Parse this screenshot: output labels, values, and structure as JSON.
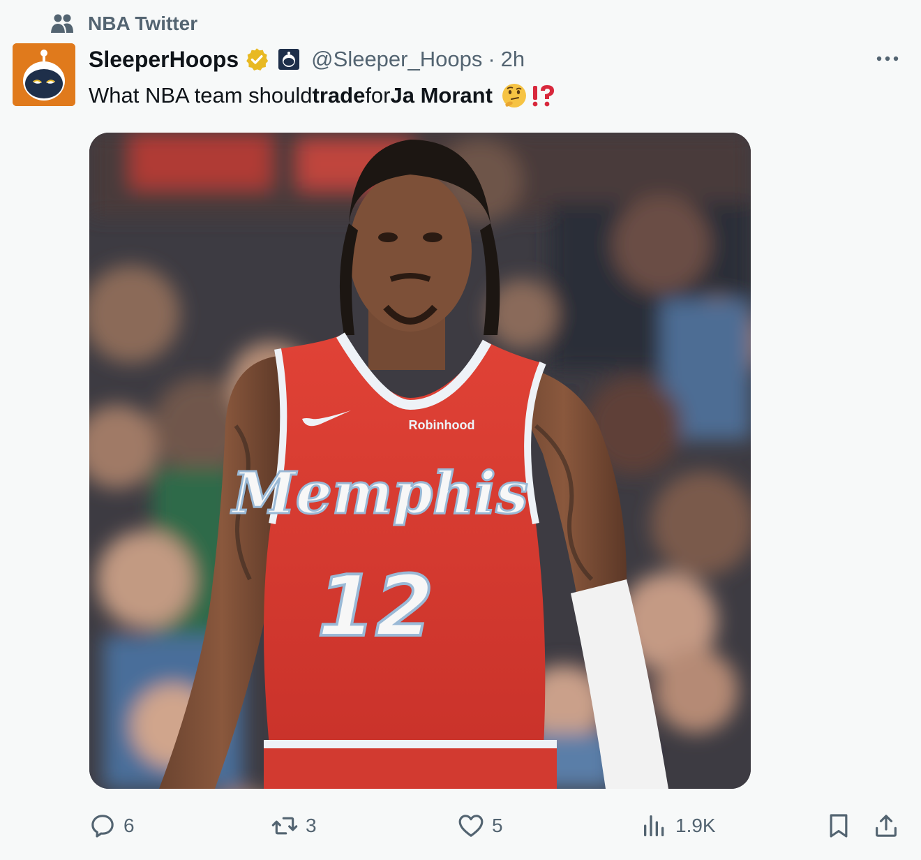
{
  "community": {
    "name": "NBA Twitter",
    "icon": "community-people-icon"
  },
  "author": {
    "display_name": "SleeperHoops",
    "handle": "@Sleeper_Hoops",
    "separator": "·",
    "time": "2h",
    "verified": true,
    "badge_color": "#e8b923"
  },
  "tweet": {
    "text_parts": [
      "What NBA team should ",
      "trade",
      " for ",
      "Ja Morant"
    ],
    "emojis": [
      "thinking-face",
      "exclamation-question-mark"
    ]
  },
  "media": {
    "jersey_text": "Memphis",
    "jersey_number": "12",
    "sponsor": "Robinhood",
    "jersey_color": "#d73a30"
  },
  "actions": {
    "replies": "6",
    "reposts": "3",
    "likes": "5",
    "views": "1.9K"
  },
  "colors": {
    "muted": "#536471",
    "text": "#0f1419",
    "background": "#f7f9f9"
  }
}
